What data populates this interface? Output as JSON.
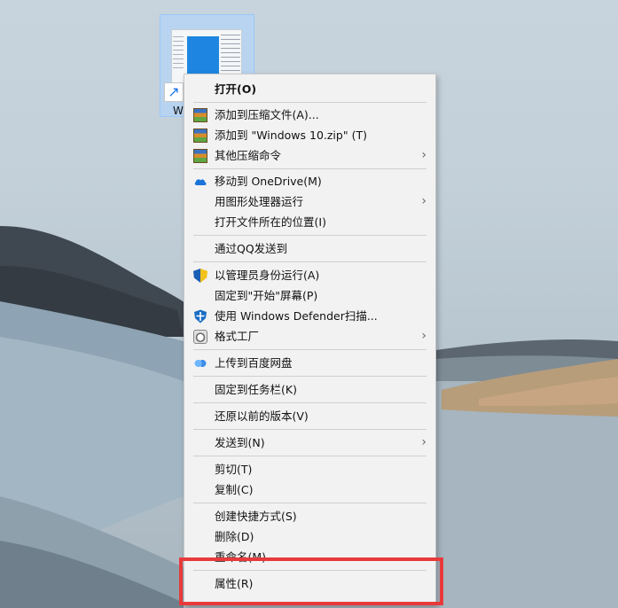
{
  "desktop": {
    "shortcut_label": "W"
  },
  "menu": {
    "open": "打开(O)",
    "add_archive": "添加到压缩文件(A)...",
    "add_zip": "添加到 \"Windows 10.zip\" (T)",
    "other_compress": "其他压缩命令",
    "move_onedrive": "移动到 OneDrive(M)",
    "gpu_run": "用图形处理器运行",
    "open_location": "打开文件所在的位置(I)",
    "send_qq": "通过QQ发送到",
    "run_admin": "以管理员身份运行(A)",
    "pin_start": "固定到\"开始\"屏幕(P)",
    "defender_scan": "使用 Windows Defender扫描...",
    "format_factory": "格式工厂",
    "upload_baidu": "上传到百度网盘",
    "pin_taskbar": "固定到任务栏(K)",
    "restore_prev": "还原以前的版本(V)",
    "send_to": "发送到(N)",
    "cut": "剪切(T)",
    "copy": "复制(C)",
    "create_shortcut": "创建快捷方式(S)",
    "delete": "删除(D)",
    "rename": "重命名(M)",
    "properties": "属性(R)"
  },
  "icons": {
    "zip": "winrar-icon",
    "onedrive": "onedrive-cloud-icon",
    "uac": "uac-shield-icon",
    "defender": "defender-shield-icon",
    "format": "format-factory-icon",
    "baidu": "baidu-netdisk-icon",
    "submenu": "chevron-right-icon"
  },
  "colors": {
    "highlight_border": "#e83a3a",
    "menu_background": "#f2f2f2"
  }
}
